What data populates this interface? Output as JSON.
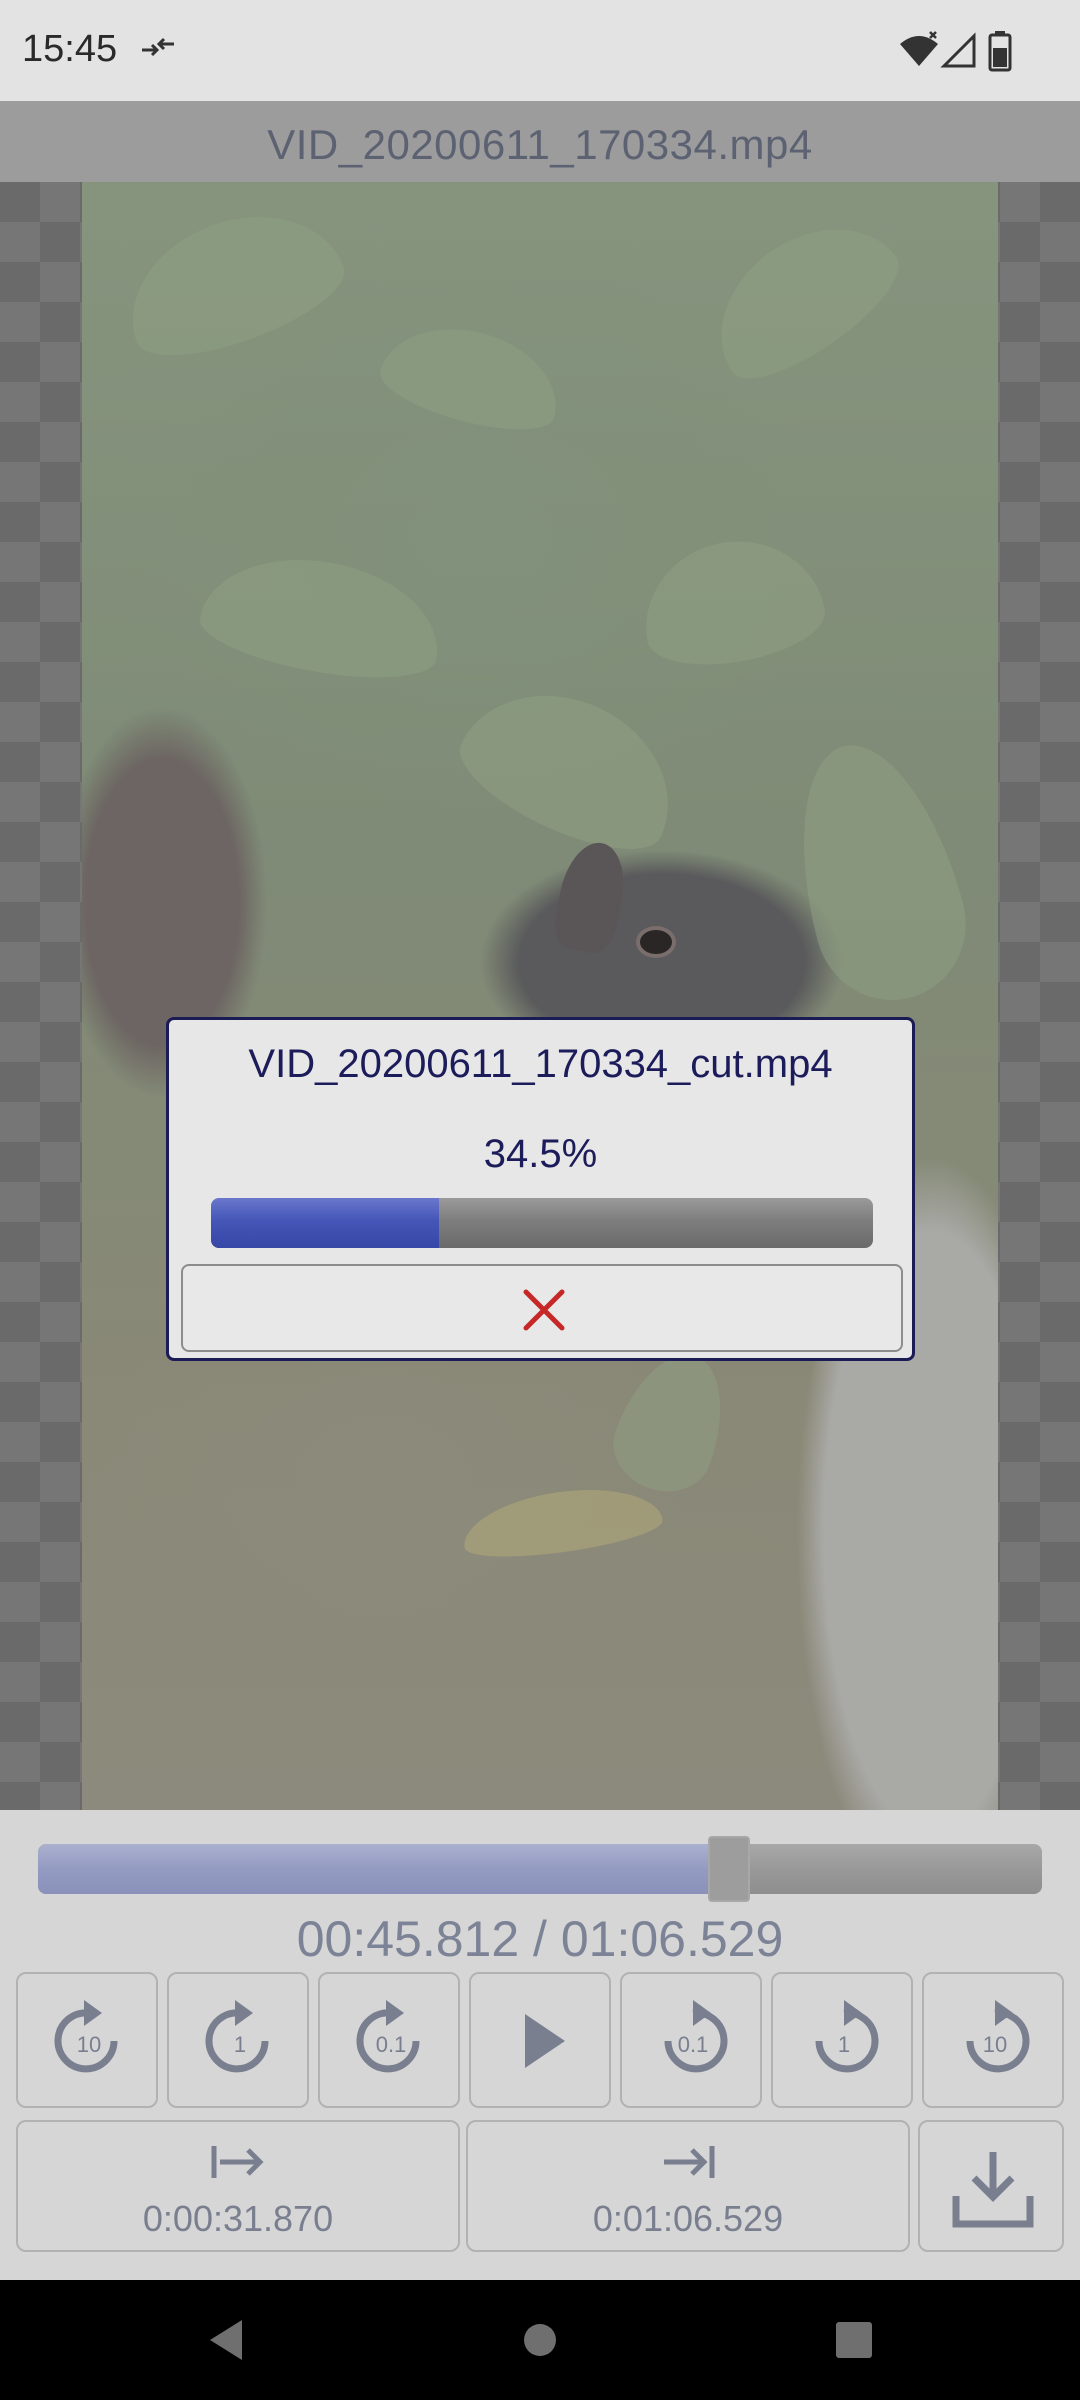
{
  "status_bar": {
    "time": "15:45",
    "icons": [
      "data-saver-icon",
      "wifi-icon",
      "signal-icon",
      "battery-icon"
    ]
  },
  "title_bar": {
    "title": "VID_20200611_170334.mp4"
  },
  "dialog": {
    "filename": "VID_20200611_170334_cut.mp4",
    "percent_label": "34.5%",
    "progress": 0.345,
    "cancel_icon": "close-icon"
  },
  "player": {
    "position": 0.688,
    "time_readout": "00:45.812 / 01:06.529",
    "seek_buttons": [
      {
        "label": "10",
        "direction": "back"
      },
      {
        "label": "1",
        "direction": "back"
      },
      {
        "label": "0.1",
        "direction": "back"
      },
      {
        "label": "play",
        "direction": "play"
      },
      {
        "label": "0.1",
        "direction": "forward"
      },
      {
        "label": "1",
        "direction": "forward"
      },
      {
        "label": "10",
        "direction": "forward"
      }
    ],
    "trim_start": "0:00:31.870",
    "trim_end": "0:01:06.529",
    "save_icon": "download-icon"
  },
  "colors": {
    "accent": "#4556b8",
    "dialog_text": "#1c1c5a",
    "cancel_red": "#c62828",
    "dimmed_text": "#7d8396"
  },
  "nav_bar": {
    "buttons": [
      "back-icon",
      "home-icon",
      "recents-icon"
    ]
  }
}
